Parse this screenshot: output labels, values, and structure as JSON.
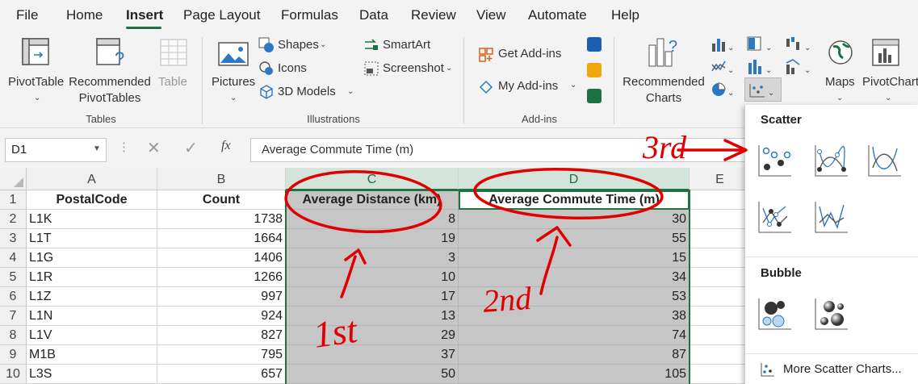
{
  "menu": {
    "tabs": [
      {
        "label": "File"
      },
      {
        "label": "Home"
      },
      {
        "label": "Insert"
      },
      {
        "label": "Page Layout"
      },
      {
        "label": "Formulas"
      },
      {
        "label": "Data"
      },
      {
        "label": "Review"
      },
      {
        "label": "View"
      },
      {
        "label": "Automate"
      },
      {
        "label": "Help"
      }
    ],
    "active_tab": "Insert",
    "accent_color": "#1e7145"
  },
  "ribbon": {
    "tables": {
      "pivottable": "PivotTable",
      "recommended_line1": "Recommended",
      "recommended_line2": "PivotTables",
      "table": "Table",
      "group": "Tables"
    },
    "illustrations": {
      "pictures": "Pictures",
      "shapes": "Shapes",
      "icons": "Icons",
      "models": "3D Models",
      "smartart": "SmartArt",
      "screenshot": "Screenshot",
      "group": "Illustrations"
    },
    "addins": {
      "get": "Get Add-ins",
      "my": "My Add-ins",
      "group": "Add-ins"
    },
    "charts": {
      "recommended_line1": "Recommended",
      "recommended_line2": "Charts"
    },
    "maps": "Maps",
    "pivotchart": "PivotChart"
  },
  "formula_bar": {
    "name_box": "D1",
    "fx": "fx",
    "formula": "Average Commute Time (m)"
  },
  "sheet": {
    "columns": [
      "A",
      "B",
      "C",
      "D",
      "E"
    ],
    "headers": [
      "PostalCode",
      "Count",
      "Average Distance (km)",
      "Average Commute Time (m)"
    ],
    "rows": [
      {
        "n": "1"
      },
      {
        "n": "2",
        "a": "L1K",
        "b": "1738",
        "c": "8",
        "d": "30"
      },
      {
        "n": "3",
        "a": "L1T",
        "b": "1664",
        "c": "19",
        "d": "55"
      },
      {
        "n": "4",
        "a": "L1G",
        "b": "1406",
        "c": "3",
        "d": "15"
      },
      {
        "n": "5",
        "a": "L1R",
        "b": "1266",
        "c": "10",
        "d": "34"
      },
      {
        "n": "6",
        "a": "L1Z",
        "b": "997",
        "c": "17",
        "d": "53"
      },
      {
        "n": "7",
        "a": "L1N",
        "b": "924",
        "c": "13",
        "d": "38"
      },
      {
        "n": "8",
        "a": "L1V",
        "b": "827",
        "c": "29",
        "d": "74"
      },
      {
        "n": "9",
        "a": "M1B",
        "b": "795",
        "c": "37",
        "d": "87"
      },
      {
        "n": "10",
        "a": "L3S",
        "b": "657",
        "c": "50",
        "d": "105"
      }
    ],
    "selection_color": "#c6c6c6"
  },
  "dropdown": {
    "scatter_title": "Scatter",
    "bubble_title": "Bubble",
    "more": "More Scatter Charts..."
  },
  "annotations": {
    "first": "1st",
    "second": "2nd",
    "third": "3rd",
    "ink_color": "#e00000"
  }
}
